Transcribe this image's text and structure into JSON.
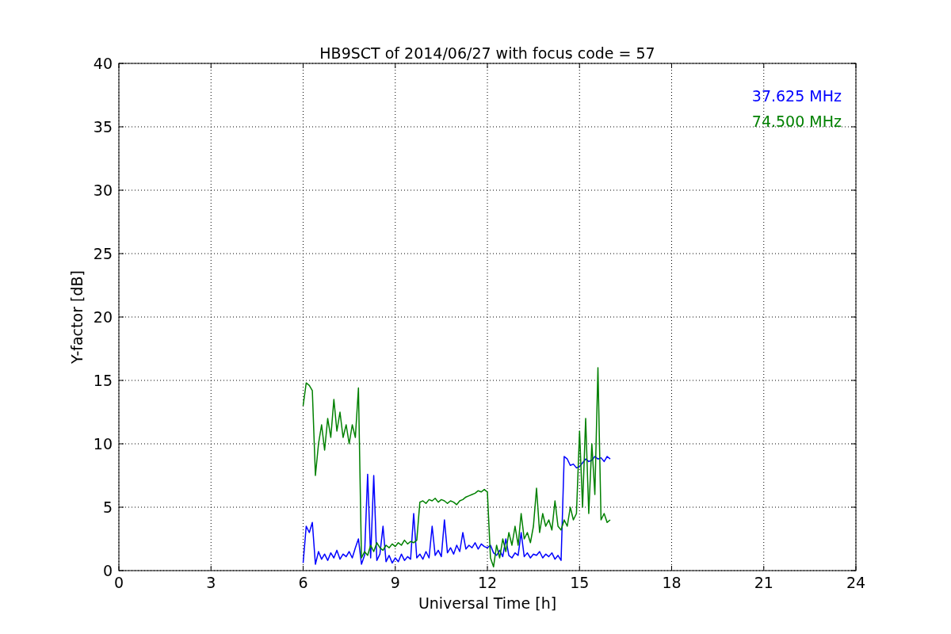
{
  "figure": {
    "chart_data": {
      "type": "line",
      "grid": true,
      "title": "HB9SCT of 2014/06/27 with focus code = 57",
      "xlabel": "Universal Time [h]",
      "ylabel": "Y-factor [dB]",
      "xlim": [
        0,
        24
      ],
      "ylim": [
        0,
        40
      ],
      "xticks": [
        0,
        3,
        6,
        9,
        12,
        15,
        18,
        21,
        24
      ],
      "yticks": [
        0,
        5,
        10,
        15,
        20,
        25,
        30,
        35,
        40
      ],
      "x": [
        6.0,
        6.1,
        6.2,
        6.3,
        6.4,
        6.5,
        6.6,
        6.7,
        6.8,
        6.9,
        7.0,
        7.1,
        7.2,
        7.3,
        7.4,
        7.5,
        7.6,
        7.7,
        7.8,
        7.9,
        8.0,
        8.1,
        8.2,
        8.3,
        8.4,
        8.5,
        8.6,
        8.7,
        8.8,
        8.9,
        9.0,
        9.1,
        9.2,
        9.3,
        9.4,
        9.5,
        9.6,
        9.7,
        9.8,
        9.9,
        10.0,
        10.1,
        10.2,
        10.3,
        10.4,
        10.5,
        10.6,
        10.7,
        10.8,
        10.9,
        11.0,
        11.1,
        11.2,
        11.3,
        11.4,
        11.5,
        11.6,
        11.7,
        11.8,
        11.9,
        12.0,
        12.1,
        12.2,
        12.3,
        12.4,
        12.5,
        12.6,
        12.7,
        12.8,
        12.9,
        13.0,
        13.1,
        13.2,
        13.3,
        13.4,
        13.5,
        13.6,
        13.7,
        13.8,
        13.9,
        14.0,
        14.1,
        14.2,
        14.3,
        14.4,
        14.5,
        14.6,
        14.7,
        14.8,
        14.9,
        15.0,
        15.1,
        15.2,
        15.3,
        15.4,
        15.5,
        15.6,
        15.7,
        15.8,
        15.9,
        16.0
      ],
      "series": [
        {
          "name": "37.625 MHz",
          "color": "#0000ff",
          "values": [
            0.6,
            3.5,
            3.0,
            3.8,
            0.5,
            1.5,
            0.9,
            1.3,
            0.8,
            1.4,
            1.0,
            1.6,
            0.9,
            1.3,
            1.1,
            1.5,
            1.0,
            1.8,
            2.5,
            0.5,
            1.2,
            7.6,
            1.0,
            7.5,
            0.8,
            1.3,
            3.5,
            0.7,
            1.2,
            0.6,
            1.0,
            0.7,
            1.3,
            0.8,
            1.1,
            0.9,
            4.5,
            1.0,
            1.3,
            0.9,
            1.5,
            1.0,
            3.5,
            1.2,
            1.6,
            1.1,
            4.0,
            1.4,
            1.8,
            1.3,
            2.0,
            1.5,
            3.0,
            1.7,
            2.0,
            1.8,
            2.2,
            1.7,
            2.1,
            1.9,
            1.8,
            2.0,
            1.4,
            1.2,
            1.6,
            1.1,
            2.5,
            1.2,
            1.0,
            1.4,
            1.2,
            3.0,
            1.1,
            1.4,
            1.0,
            1.3,
            1.2,
            1.5,
            1.0,
            1.3,
            1.1,
            1.4,
            0.9,
            1.2,
            0.8,
            9.0,
            8.8,
            8.3,
            8.4,
            8.1,
            8.2,
            8.5,
            8.8,
            8.6,
            8.7,
            9.0,
            8.8,
            8.9,
            8.6,
            9.0,
            8.8
          ]
        },
        {
          "name": "74.500 MHz",
          "color": "#008000",
          "values": [
            13.0,
            14.8,
            14.6,
            14.2,
            7.5,
            10.0,
            11.5,
            9.5,
            12.0,
            10.5,
            13.5,
            11.0,
            12.5,
            10.5,
            11.5,
            10.0,
            11.5,
            10.5,
            14.4,
            1.0,
            1.5,
            1.2,
            2.0,
            1.5,
            2.2,
            1.8,
            1.6,
            2.0,
            1.8,
            2.1,
            1.9,
            2.2,
            2.0,
            2.4,
            2.1,
            2.3,
            2.2,
            2.4,
            5.4,
            5.5,
            5.3,
            5.6,
            5.5,
            5.7,
            5.4,
            5.6,
            5.5,
            5.3,
            5.5,
            5.4,
            5.2,
            5.5,
            5.6,
            5.8,
            5.9,
            6.0,
            6.1,
            6.3,
            6.2,
            6.4,
            6.2,
            1.0,
            0.3,
            2.0,
            1.0,
            2.5,
            1.5,
            3.0,
            2.0,
            3.5,
            2.0,
            4.5,
            2.5,
            3.0,
            2.2,
            3.5,
            6.5,
            3.0,
            4.5,
            3.5,
            4.0,
            3.2,
            5.5,
            3.5,
            3.2,
            4.0,
            3.5,
            5.0,
            4.0,
            4.5,
            11.0,
            5.0,
            12.0,
            4.5,
            10.0,
            6.0,
            16.0,
            4.0,
            4.5,
            3.8,
            4.0
          ]
        }
      ]
    }
  }
}
